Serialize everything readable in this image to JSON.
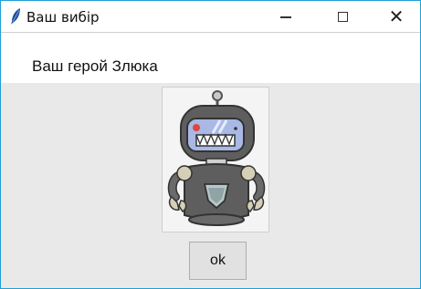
{
  "window": {
    "title": "Ваш вибір",
    "minimize_symbol": "—",
    "maximize_symbol": "☐",
    "close_symbol": "✕",
    "icon": "feather-icon"
  },
  "content": {
    "hero_label": "Ваш герой Злюка",
    "image": "angry-robot-illustration",
    "ok_label": "ok"
  },
  "colors": {
    "window_border": "#1fa0d6",
    "window_background": "#e9e9e9",
    "robot_body": "#5e5e5e",
    "robot_visor": "#a9b8e4"
  }
}
